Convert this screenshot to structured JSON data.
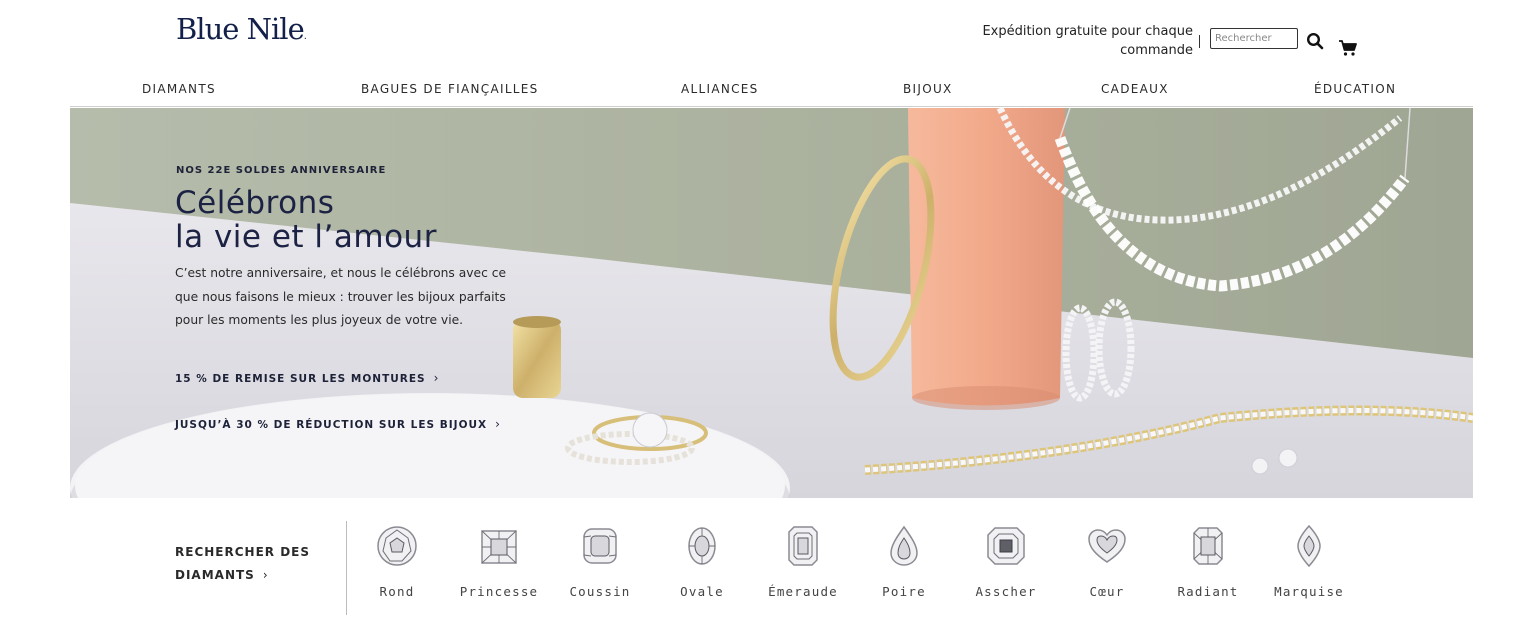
{
  "header": {
    "logo_text": "Blue Nile",
    "logo_dot": ".",
    "shipping_line1": "Expédition gratuite pour chaque",
    "shipping_line2": "commande",
    "search_placeholder": "Rechercher",
    "icons": [
      "search-icon",
      "cart-icon"
    ]
  },
  "nav": {
    "items": [
      {
        "label": "DIAMANTS"
      },
      {
        "label": "BAGUES DE FIANÇAILLES"
      },
      {
        "label": "ALLIANCES"
      },
      {
        "label": "BIJOUX"
      },
      {
        "label": "CADEAUX"
      },
      {
        "label": "ÉDUCATION"
      }
    ]
  },
  "hero": {
    "eyebrow": "NOS 22E SOLDES ANNIVERSAIRE",
    "headline": "Célébrons\nla vie et l’amour",
    "body": "C’est notre anniversaire, et nous le célébrons avec ce que nous faisons le mieux : trouver les bijoux parfaits pour les moments les plus joyeux de votre vie.",
    "cta1": "15 % DE REMISE SUR LES MONTURES",
    "cta2": "JUSQU’À 30 % DE RÉDUCTION SUR LES BIJOUX",
    "chevron": "›"
  },
  "shapes": {
    "title_line1": "RECHERCHER DES",
    "title_line2": "DIAMANTS",
    "chevron": "›",
    "items": [
      {
        "label": "Rond"
      },
      {
        "label": "Princesse"
      },
      {
        "label": "Coussin"
      },
      {
        "label": "Ovale"
      },
      {
        "label": "Émeraude"
      },
      {
        "label": "Poire"
      },
      {
        "label": "Asscher"
      },
      {
        "label": "Cœur"
      },
      {
        "label": "Radiant"
      },
      {
        "label": "Marquise"
      }
    ]
  },
  "colors": {
    "brand": "#13204a",
    "hero_wall": "#a5ac98",
    "hero_table": "#e4e3e8",
    "pillar": "#f2a98a",
    "gold": "#d9c27a"
  }
}
